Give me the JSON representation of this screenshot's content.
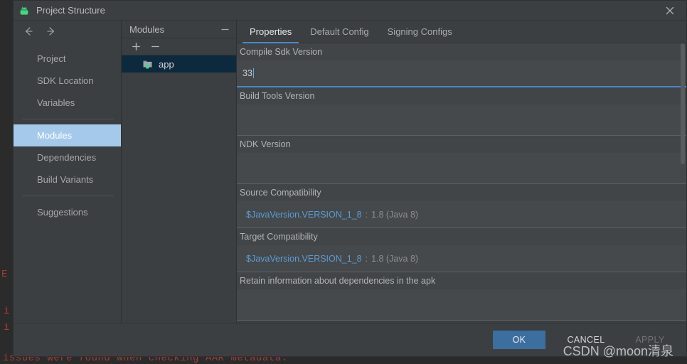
{
  "background": {
    "error_line": "issues were found when checking AAR metadata:",
    "fragments": [
      "E",
      "|",
      "i",
      "i"
    ]
  },
  "dialog": {
    "title": "Project Structure",
    "icon": "android-robot-icon",
    "close_icon": "close-icon"
  },
  "nav": {
    "back_icon": "arrow-left-icon",
    "forward_icon": "arrow-right-icon"
  },
  "sidebar": {
    "items": [
      {
        "label": "Project",
        "selected": false
      },
      {
        "label": "SDK Location",
        "selected": false
      },
      {
        "label": "Variables",
        "selected": false
      },
      {
        "label": "Modules",
        "selected": true
      },
      {
        "label": "Dependencies",
        "selected": false
      },
      {
        "label": "Build Variants",
        "selected": false
      },
      {
        "label": "Suggestions",
        "selected": false
      }
    ]
  },
  "modules_panel": {
    "title": "Modules",
    "collapse_icon": "minimize-icon",
    "add_icon": "plus-icon",
    "remove_icon": "minus-icon",
    "tree": [
      {
        "label": "app",
        "icon": "module-folder-icon",
        "selected": true
      }
    ]
  },
  "tabs": [
    {
      "label": "Properties",
      "active": true
    },
    {
      "label": "Default Config",
      "active": false
    },
    {
      "label": "Signing Configs",
      "active": false
    }
  ],
  "fields": [
    {
      "label": "Compile Sdk Version",
      "value": "33",
      "focused": true,
      "type": "text"
    },
    {
      "label": "Build Tools Version",
      "value": "",
      "focused": false,
      "type": "text"
    },
    {
      "label": "NDK Version",
      "value": "",
      "focused": false,
      "type": "text"
    },
    {
      "label": "Source Compatibility",
      "variable": "$JavaVersion.VERSION_1_8",
      "separator": ":",
      "resolved": "1.8 (Java 8)",
      "focused": false,
      "type": "variable"
    },
    {
      "label": "Target Compatibility",
      "variable": "$JavaVersion.VERSION_1_8",
      "separator": ":",
      "resolved": "1.8 (Java 8)",
      "focused": false,
      "type": "variable"
    },
    {
      "label": "Retain information about dependencies in the apk",
      "value": "",
      "focused": false,
      "type": "text"
    }
  ],
  "buttons": {
    "ok": "OK",
    "cancel": "CANCEL",
    "apply": "APPLY"
  },
  "watermark": "CSDN @moon清泉",
  "colors": {
    "accent_blue": "#4a88c7",
    "selection_blue": "#a5c9ea",
    "tree_selection": "#0d293e",
    "variable_blue": "#5b9bd5",
    "error_red": "#a53a34",
    "android_green": "#3ddc84"
  }
}
